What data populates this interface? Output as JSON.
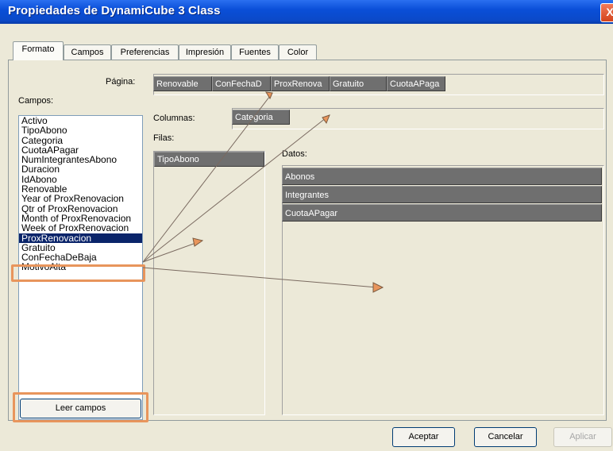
{
  "window": {
    "title": "Propiedades de DynamiCube 3 Class",
    "close_glyph": "X"
  },
  "tabs": [
    "Formato",
    "Campos",
    "Preferencias",
    "Impresión",
    "Fuentes",
    "Color"
  ],
  "labels": {
    "pagina": "Página:",
    "campos": "Campos:",
    "columnas": "Columnas:",
    "filas": "Filas:",
    "datos": "Datos:"
  },
  "fields_list": [
    "Activo",
    "TipoAbono",
    "Categoria",
    "CuotaAPagar",
    "NumIntegrantesAbono",
    "Duracion",
    "IdAbono",
    "Renovable",
    "Year of ProxRenovacion",
    "Qtr of ProxRenovacion",
    "Month of ProxRenovacion",
    "Week of ProxRenovacion",
    "ProxRenovacion",
    "Gratuito",
    "ConFechaDeBaja",
    "MotivoAlta"
  ],
  "selected_field": "ProxRenovacion",
  "page_fields": [
    "Renovable",
    "ConFechaD",
    "ProxRenova",
    "Gratuito",
    "CuotaAPaga"
  ],
  "column_fields": [
    "Categoria"
  ],
  "row_fields": [
    "TipoAbono"
  ],
  "data_fields": [
    "Abonos",
    "Integrantes",
    "CuotaAPagar"
  ],
  "buttons": {
    "leer_campos": "Leer campos",
    "aceptar": "Aceptar",
    "cancelar": "Cancelar",
    "aplicar": "Aplicar"
  },
  "colors": {
    "annotation": "#e8955c",
    "titlebar": "#0a4fd8",
    "chip": "#6f6f6f",
    "selection": "#0a246a"
  }
}
